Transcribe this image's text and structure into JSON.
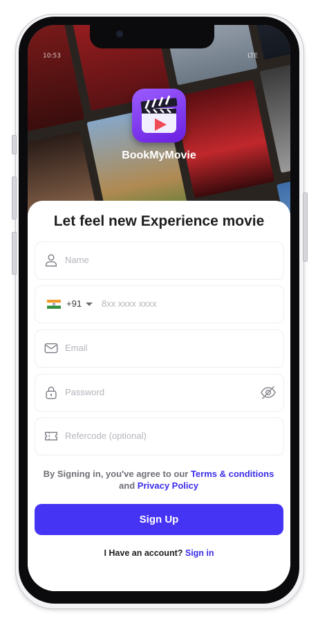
{
  "status": {
    "time": "10:53",
    "network": "LTE"
  },
  "app": {
    "name": "BookMyMovie"
  },
  "form": {
    "heading": "Let feel new Experience movie",
    "name_placeholder": "Name",
    "country_code": "+91",
    "phone_placeholder": "8xx xxxx xxxx",
    "email_placeholder": "Email",
    "password_placeholder": "Password",
    "refcode_placeholder": "Refercode (optional)"
  },
  "terms": {
    "prefix": "By Signing in, you've agree to our ",
    "terms_link": "Terms & conditions",
    "and": " and ",
    "privacy_link": "Privacy Policy"
  },
  "signup": {
    "label": "Sign Up"
  },
  "signin": {
    "prompt": "I Have an account? ",
    "link": "Sign in"
  },
  "colors": {
    "accent": "#4634f5",
    "link": "#3b2de8",
    "logo": "#8a45ff"
  }
}
